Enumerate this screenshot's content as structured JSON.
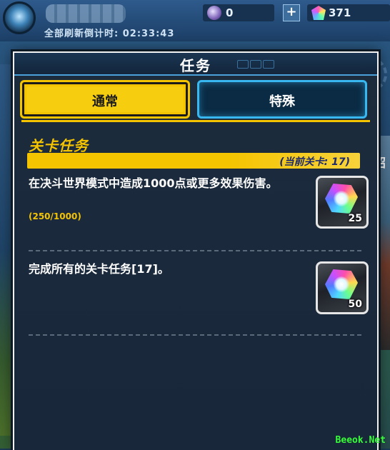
{
  "topbar": {
    "countdown": "全部刷新倒计时: 02:33:43",
    "orb_count": "0",
    "plus_label": "+",
    "gem_count": "371"
  },
  "background": {
    "side_text": "绍"
  },
  "panel": {
    "title": "任务",
    "tabs": [
      {
        "label": "通常",
        "active": true
      },
      {
        "label": "特殊",
        "active": false
      }
    ],
    "section_title": "关卡任务",
    "current_stage": "(当前关卡: 17)",
    "missions": [
      {
        "text": "在决斗世界模式中造成1000点或更多效果伤害。",
        "progress": "(250/1000)",
        "reward_count": "25",
        "reward_icon": "rainbow-gem-icon"
      },
      {
        "text": "完成所有的关卡任务[17]。",
        "progress": "",
        "reward_count": "50",
        "reward_icon": "rainbow-gem-icon"
      }
    ]
  },
  "watermark": "Beeok.Net",
  "colors": {
    "accent_yellow": "#f5c400",
    "tab_blue": "#38b7f0",
    "panel_bg": "#1c2c3d"
  }
}
